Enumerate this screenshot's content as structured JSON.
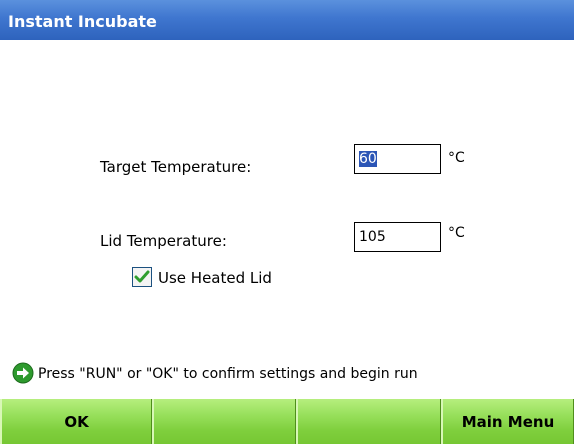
{
  "window": {
    "title": "Instant Incubate"
  },
  "form": {
    "target_label": "Target Temperature:",
    "target_value": "60",
    "target_unit": "°C",
    "lid_label": "Lid Temperature:",
    "lid_value": "105",
    "lid_unit": "°C",
    "heated_lid_label": "Use Heated Lid",
    "heated_lid_checked": true
  },
  "hint": {
    "text": "Press \"RUN\" or \"OK\" to confirm settings and begin run",
    "icon": "arrow-right-circle-icon"
  },
  "softkeys": [
    "OK",
    "",
    "",
    "Main Menu"
  ],
  "colors": {
    "title_bar": "#3f76cf",
    "softkey": "#98e05c",
    "check": "#2f9e2f",
    "selection": "#2b55b6"
  }
}
